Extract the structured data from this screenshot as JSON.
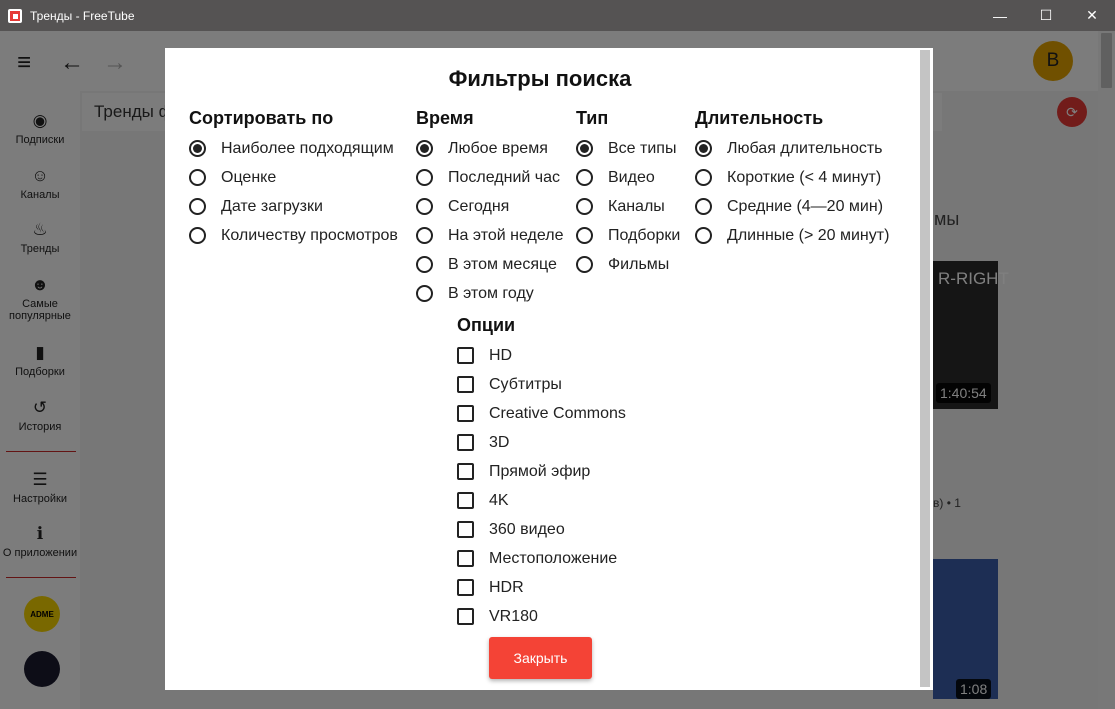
{
  "window": {
    "title": "Тренды - FreeTube",
    "minimize": "—",
    "maximize": "☐",
    "close": "✕"
  },
  "topnav": {
    "avatar_letter": "В",
    "menu_icon": "≡",
    "back_icon": "←",
    "forward_icon": "→"
  },
  "sidebar": {
    "items": [
      {
        "label": "Подписки",
        "icon": "rss-icon",
        "glyph": "◉"
      },
      {
        "label": "Каналы",
        "icon": "user-check-icon",
        "glyph": "☺"
      },
      {
        "label": "Тренды",
        "icon": "fire-icon",
        "glyph": "♨"
      },
      {
        "label": "Самые популярные",
        "icon": "users-icon",
        "glyph": "☻"
      },
      {
        "label": "Подборки",
        "icon": "bookmark-icon",
        "glyph": "▮"
      },
      {
        "label": "История",
        "icon": "history-icon",
        "glyph": "↺"
      },
      {
        "label": "Настройки",
        "icon": "sliders-icon",
        "glyph": "☰"
      },
      {
        "label": "О приложении",
        "icon": "info-icon",
        "glyph": "ℹ"
      }
    ],
    "channel_avatar_1": "ADME"
  },
  "content": {
    "header": "Тренды ф",
    "bg_fragment_1": "мы",
    "bg_fragment_2": "R-RIGHT",
    "bg_fragment_3": "в) • 1",
    "bg_duration_1": "1:40:54",
    "bg_duration_2": "1:08"
  },
  "modal": {
    "title": "Фильтры поиска",
    "sort": {
      "title": "Сортировать по",
      "options": [
        "Наиболее подходящим",
        "Оценке",
        "Дате загрузки",
        "Количеству просмотров"
      ],
      "selected": 0
    },
    "time": {
      "title": "Время",
      "options": [
        "Любое время",
        "Последний час",
        "Сегодня",
        "На этой неделе",
        "В этом месяце",
        "В этом году"
      ],
      "selected": 0
    },
    "type": {
      "title": "Тип",
      "options": [
        "Все типы",
        "Видео",
        "Каналы",
        "Подборки",
        "Фильмы"
      ],
      "selected": 0
    },
    "duration": {
      "title": "Длительность",
      "options": [
        "Любая длительность",
        "Короткие (< 4 минут)",
        "Средние (4—20 мин)",
        "Длинные (> 20 минут)"
      ],
      "selected": 0
    },
    "features": {
      "title": "Опции",
      "options": [
        "HD",
        "Субтитры",
        "Creative Commons",
        "3D",
        "Прямой эфир",
        "4K",
        "360 видео",
        "Местоположение",
        "HDR",
        "VR180"
      ]
    },
    "close_label": "Закрыть"
  }
}
